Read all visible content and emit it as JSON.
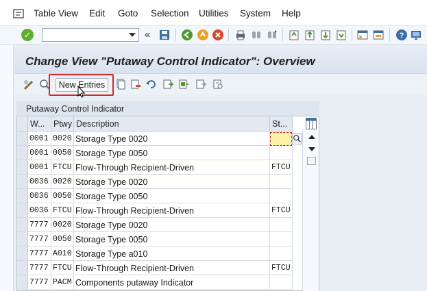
{
  "menu": [
    "Table View",
    "Edit",
    "Goto",
    "Selection",
    "Utilities",
    "System",
    "Help"
  ],
  "command_field": {
    "value": "",
    "placeholder": ""
  },
  "title": "Change View \"Putaway Control Indicator\": Overview",
  "app_toolbar": {
    "new_entries_label": "New Entries"
  },
  "table": {
    "title": "Putaway Control Indicator",
    "headers": [
      "W...",
      "Ptwy",
      "Description",
      "St..."
    ],
    "rows": [
      [
        "0001",
        "0020",
        "Storage Type 0020",
        ""
      ],
      [
        "0001",
        "0050",
        "Storage Type 0050",
        ""
      ],
      [
        "0001",
        "FTCU",
        "Flow-Through Recipient-Driven",
        "FTCU"
      ],
      [
        "0036",
        "0020",
        "Storage Type 0020",
        ""
      ],
      [
        "0036",
        "0050",
        "Storage Type 0050",
        ""
      ],
      [
        "0036",
        "FTCU",
        "Flow-Through Recipient-Driven",
        "FTCU"
      ],
      [
        "7777",
        "0020",
        "Storage Type 0020",
        ""
      ],
      [
        "7777",
        "0050",
        "Storage Type 0050",
        ""
      ],
      [
        "7777",
        "A010",
        "Storage Type a010",
        ""
      ],
      [
        "7777",
        "FTCU",
        "Flow-Through Recipient-Driven",
        "FTCU"
      ],
      [
        "7777",
        "PACM",
        "Components putaway Indicator",
        ""
      ]
    ]
  },
  "colors": {
    "highlight": "#d0282e",
    "active_cell": "#fdf3a8",
    "title_bg": "#dde6f0"
  }
}
